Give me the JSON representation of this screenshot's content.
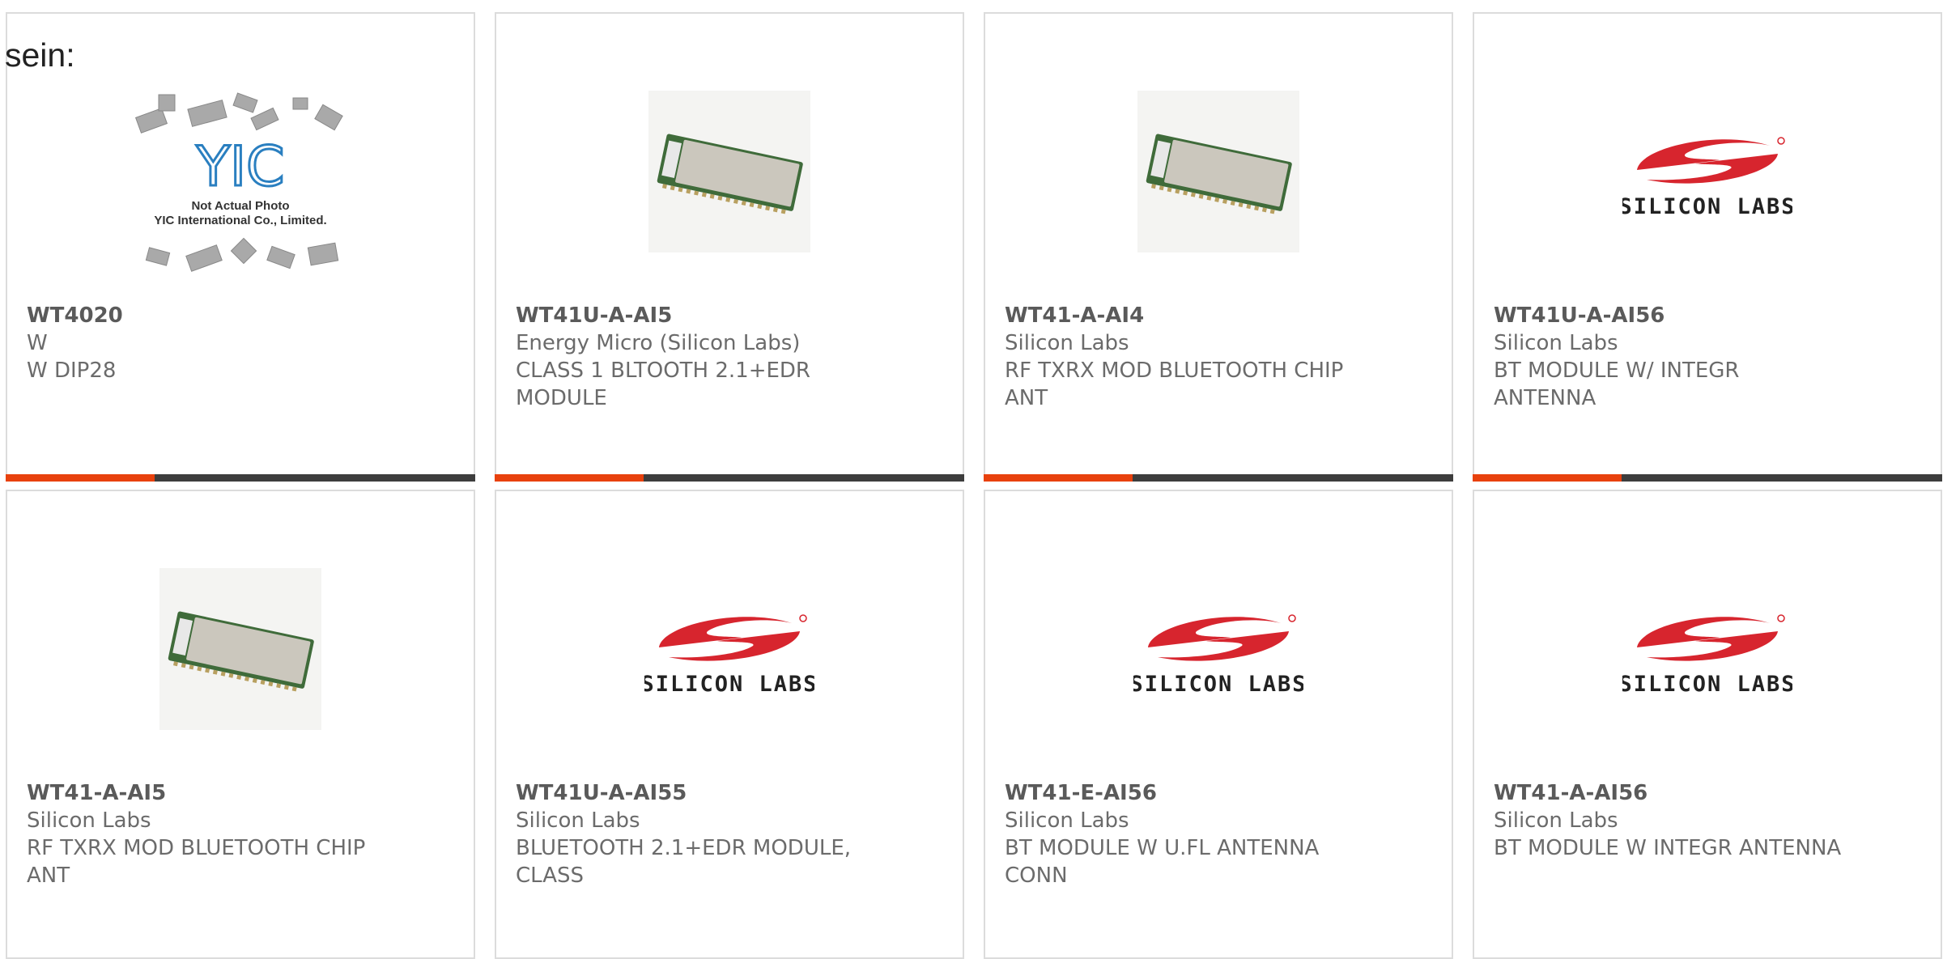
{
  "lead_text": "sein:",
  "colors": {
    "accent": "#e8410d",
    "bar": "#3d3d3d",
    "border": "#dcdcdc",
    "silabs_red": "#d7252e"
  },
  "placeholder_caption": [
    "Not Actual Photo",
    "YIC International Co., Limited."
  ],
  "placeholder_logo": "YIC",
  "silabs_logo_text": "SILICON LABS",
  "products": [
    {
      "part": "WT4020",
      "manufacturer": "W",
      "desc": [
        "W DIP28"
      ],
      "image": "yic-placeholder",
      "accent_bar": true
    },
    {
      "part": "WT41U-A-AI5",
      "manufacturer": "Energy Micro (Silicon Labs)",
      "desc": [
        "CLASS 1 BLTOOTH 2.1+EDR",
        "MODULE"
      ],
      "image": "module-photo",
      "accent_bar": true
    },
    {
      "part": "WT41-A-AI4",
      "manufacturer": "Silicon Labs",
      "desc": [
        "RF TXRX MOD BLUETOOTH CHIP",
        "ANT"
      ],
      "image": "module-photo",
      "accent_bar": true
    },
    {
      "part": "WT41U-A-AI56",
      "manufacturer": "Silicon Labs",
      "desc": [
        "BT MODULE W/ INTEGR",
        "ANTENNA"
      ],
      "image": "silabs-logo",
      "accent_bar": true
    },
    {
      "part": "WT41-A-AI5",
      "manufacturer": "Silicon Labs",
      "desc": [
        "RF TXRX MOD BLUETOOTH CHIP",
        "ANT"
      ],
      "image": "module-photo",
      "accent_bar": false
    },
    {
      "part": "WT41U-A-AI55",
      "manufacturer": "Silicon Labs",
      "desc": [
        "BLUETOOTH 2.1+EDR MODULE,",
        "CLASS"
      ],
      "image": "silabs-logo",
      "accent_bar": false
    },
    {
      "part": "WT41-E-AI56",
      "manufacturer": "Silicon Labs",
      "desc": [
        "BT MODULE W U.FL ANTENNA",
        "CONN"
      ],
      "image": "silabs-logo",
      "accent_bar": false
    },
    {
      "part": "WT41-A-AI56",
      "manufacturer": "Silicon Labs",
      "desc": [
        "BT MODULE W INTEGR ANTENNA"
      ],
      "image": "silabs-logo",
      "accent_bar": false
    }
  ]
}
